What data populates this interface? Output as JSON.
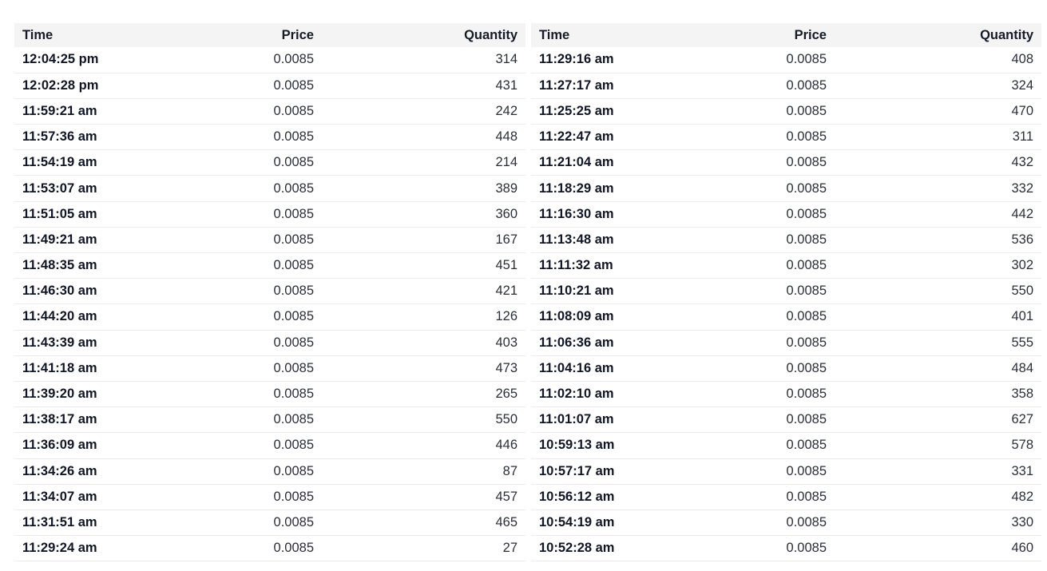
{
  "columns": {
    "time": "Time",
    "price": "Price",
    "quantity": "Quantity"
  },
  "left_trades": [
    {
      "time": "12:04:25 pm",
      "price": "0.0085",
      "quantity": "314"
    },
    {
      "time": "12:02:28 pm",
      "price": "0.0085",
      "quantity": "431"
    },
    {
      "time": "11:59:21 am",
      "price": "0.0085",
      "quantity": "242"
    },
    {
      "time": "11:57:36 am",
      "price": "0.0085",
      "quantity": "448"
    },
    {
      "time": "11:54:19 am",
      "price": "0.0085",
      "quantity": "214"
    },
    {
      "time": "11:53:07 am",
      "price": "0.0085",
      "quantity": "389"
    },
    {
      "time": "11:51:05 am",
      "price": "0.0085",
      "quantity": "360"
    },
    {
      "time": "11:49:21 am",
      "price": "0.0085",
      "quantity": "167"
    },
    {
      "time": "11:48:35 am",
      "price": "0.0085",
      "quantity": "451"
    },
    {
      "time": "11:46:30 am",
      "price": "0.0085",
      "quantity": "421"
    },
    {
      "time": "11:44:20 am",
      "price": "0.0085",
      "quantity": "126"
    },
    {
      "time": "11:43:39 am",
      "price": "0.0085",
      "quantity": "403"
    },
    {
      "time": "11:41:18 am",
      "price": "0.0085",
      "quantity": "473"
    },
    {
      "time": "11:39:20 am",
      "price": "0.0085",
      "quantity": "265"
    },
    {
      "time": "11:38:17 am",
      "price": "0.0085",
      "quantity": "550"
    },
    {
      "time": "11:36:09 am",
      "price": "0.0085",
      "quantity": "446"
    },
    {
      "time": "11:34:26 am",
      "price": "0.0085",
      "quantity": "87"
    },
    {
      "time": "11:34:07 am",
      "price": "0.0085",
      "quantity": "457"
    },
    {
      "time": "11:31:51 am",
      "price": "0.0085",
      "quantity": "465"
    },
    {
      "time": "11:29:24 am",
      "price": "0.0085",
      "quantity": "27"
    }
  ],
  "right_trades": [
    {
      "time": "11:29:16 am",
      "price": "0.0085",
      "quantity": "408"
    },
    {
      "time": "11:27:17 am",
      "price": "0.0085",
      "quantity": "324"
    },
    {
      "time": "11:25:25 am",
      "price": "0.0085",
      "quantity": "470"
    },
    {
      "time": "11:22:47 am",
      "price": "0.0085",
      "quantity": "311"
    },
    {
      "time": "11:21:04 am",
      "price": "0.0085",
      "quantity": "432"
    },
    {
      "time": "11:18:29 am",
      "price": "0.0085",
      "quantity": "332"
    },
    {
      "time": "11:16:30 am",
      "price": "0.0085",
      "quantity": "442"
    },
    {
      "time": "11:13:48 am",
      "price": "0.0085",
      "quantity": "536"
    },
    {
      "time": "11:11:32 am",
      "price": "0.0085",
      "quantity": "302"
    },
    {
      "time": "11:10:21 am",
      "price": "0.0085",
      "quantity": "550"
    },
    {
      "time": "11:08:09 am",
      "price": "0.0085",
      "quantity": "401"
    },
    {
      "time": "11:06:36 am",
      "price": "0.0085",
      "quantity": "555"
    },
    {
      "time": "11:04:16 am",
      "price": "0.0085",
      "quantity": "484"
    },
    {
      "time": "11:02:10 am",
      "price": "0.0085",
      "quantity": "358"
    },
    {
      "time": "11:01:07 am",
      "price": "0.0085",
      "quantity": "627"
    },
    {
      "time": "10:59:13 am",
      "price": "0.0085",
      "quantity": "578"
    },
    {
      "time": "10:57:17 am",
      "price": "0.0085",
      "quantity": "331"
    },
    {
      "time": "10:56:12 am",
      "price": "0.0085",
      "quantity": "482"
    },
    {
      "time": "10:54:19 am",
      "price": "0.0085",
      "quantity": "330"
    },
    {
      "time": "10:52:28 am",
      "price": "0.0085",
      "quantity": "460"
    }
  ]
}
